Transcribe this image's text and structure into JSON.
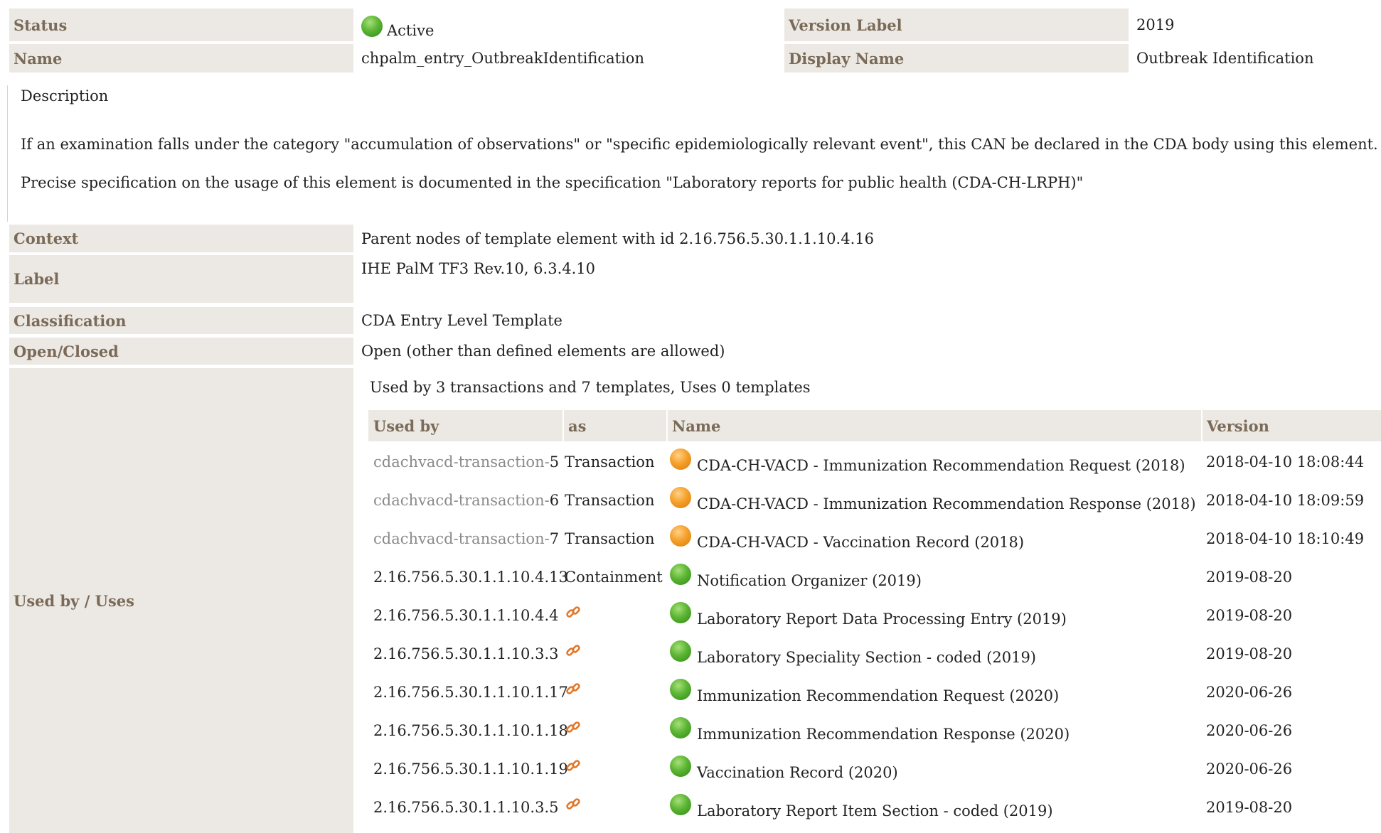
{
  "rows": {
    "status": {
      "label": "Status",
      "value": "Active",
      "icon": "green-status-ball"
    },
    "version_label": {
      "label": "Version Label",
      "value": "2019"
    },
    "name": {
      "label": "Name",
      "value": "chpalm_entry_OutbreakIdentification"
    },
    "display_name": {
      "label": "Display Name",
      "value": "Outbreak Identification"
    },
    "context": {
      "label": "Context",
      "value": "Parent nodes of template element with id 2.16.756.5.30.1.1.10.4.16"
    },
    "label": {
      "label": "Label",
      "value": "IHE PalM TF3 Rev.10, 6.3.4.10"
    },
    "classification": {
      "label": "Classification",
      "value": "CDA Entry Level Template"
    },
    "open_closed": {
      "label": "Open/Closed",
      "value": "Open (other than defined elements are allowed)"
    },
    "used_by_uses": {
      "label": "Used by / Uses"
    }
  },
  "description": {
    "heading": "Description",
    "paragraphs": [
      "If an examination falls under the category \"accumulation of observations\" or \"specific epidemiologically relevant event\", this CAN be declared in the CDA body using this element.",
      "Precise specification on the usage of this element is documented in the specification \"Laboratory reports for public health (CDA-CH-LRPH)\""
    ]
  },
  "usage": {
    "summary": "Used by 3 transactions and 7 templates, Uses 0 templates",
    "columns": [
      "Used by",
      "as",
      "Name",
      "Version"
    ],
    "items": [
      {
        "prefix": "cdachvacd-transaction-",
        "num": "5",
        "as": "Transaction",
        "status": "orange",
        "name": "CDA-CH-VACD - Immunization Recommendation Request (2018)",
        "version": "2018-04-10 18:08:44"
      },
      {
        "prefix": "cdachvacd-transaction-",
        "num": "6",
        "as": "Transaction",
        "status": "orange",
        "name": "CDA-CH-VACD - Immunization Recommendation Response (2018)",
        "version": "2018-04-10 18:09:59"
      },
      {
        "prefix": "cdachvacd-transaction-",
        "num": "7",
        "as": "Transaction",
        "status": "orange",
        "name": "CDA-CH-VACD - Vaccination Record (2018)",
        "version": "2018-04-10 18:10:49"
      },
      {
        "prefix": "",
        "num": "2.16.756.5.30.1.1.10.4.13",
        "as": "Containment",
        "status": "green",
        "name": "Notification Organizer (2019)",
        "version": "2019-08-20"
      },
      {
        "prefix": "",
        "num": "2.16.756.5.30.1.1.10.4.4",
        "as": "",
        "link": true,
        "status": "green",
        "name": "Laboratory Report Data Processing Entry (2019)",
        "version": "2019-08-20"
      },
      {
        "prefix": "",
        "num": "2.16.756.5.30.1.1.10.3.3",
        "as": "",
        "link": true,
        "status": "green",
        "name": "Laboratory Speciality Section - coded (2019)",
        "version": "2019-08-20"
      },
      {
        "prefix": "",
        "num": "2.16.756.5.30.1.1.10.1.17",
        "as": "",
        "link": true,
        "status": "green",
        "name": "Immunization Recommendation Request (2020)",
        "version": "2020-06-26"
      },
      {
        "prefix": "",
        "num": "2.16.756.5.30.1.1.10.1.18",
        "as": "",
        "link": true,
        "status": "green",
        "name": "Immunization Recommendation Response (2020)",
        "version": "2020-06-26"
      },
      {
        "prefix": "",
        "num": "2.16.756.5.30.1.1.10.1.19",
        "as": "",
        "link": true,
        "status": "green",
        "name": "Vaccination Record (2020)",
        "version": "2020-06-26"
      },
      {
        "prefix": "",
        "num": "2.16.756.5.30.1.1.10.3.5",
        "as": "",
        "link": true,
        "status": "green",
        "name": "Laboratory Report Item Section - coded (2019)",
        "version": "2019-08-20"
      }
    ]
  },
  "colors": {
    "label_bg": "#ece8e3",
    "label_fg": "#7a6a58",
    "link_orange": "#e0782a"
  }
}
